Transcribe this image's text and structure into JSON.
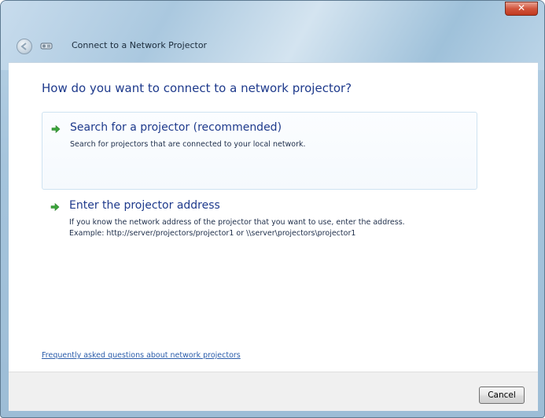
{
  "window": {
    "title": "Connect to a Network Projector",
    "close_label": "✕"
  },
  "main": {
    "heading": "How do you want to connect to a network projector?",
    "options": [
      {
        "title": "Search for a projector (recommended)",
        "description_lines": [
          "Search for projectors that are connected to your local network."
        ],
        "icon": "green-arrow-icon"
      },
      {
        "title": "Enter the projector address",
        "description_lines": [
          "If you know the network address of the projector that you want to use, enter the address.",
          "Example: http://server/projectors/projector1 or \\\\server\\projectors\\projector1"
        ],
        "icon": "green-arrow-icon"
      }
    ],
    "faq_link": "Frequently asked questions about network projectors"
  },
  "footer": {
    "cancel_label": "Cancel"
  },
  "colors": {
    "heading": "#1e3a8c",
    "link": "#2a5caa",
    "arrow": "#3aa53a",
    "close": "#c0391e"
  }
}
